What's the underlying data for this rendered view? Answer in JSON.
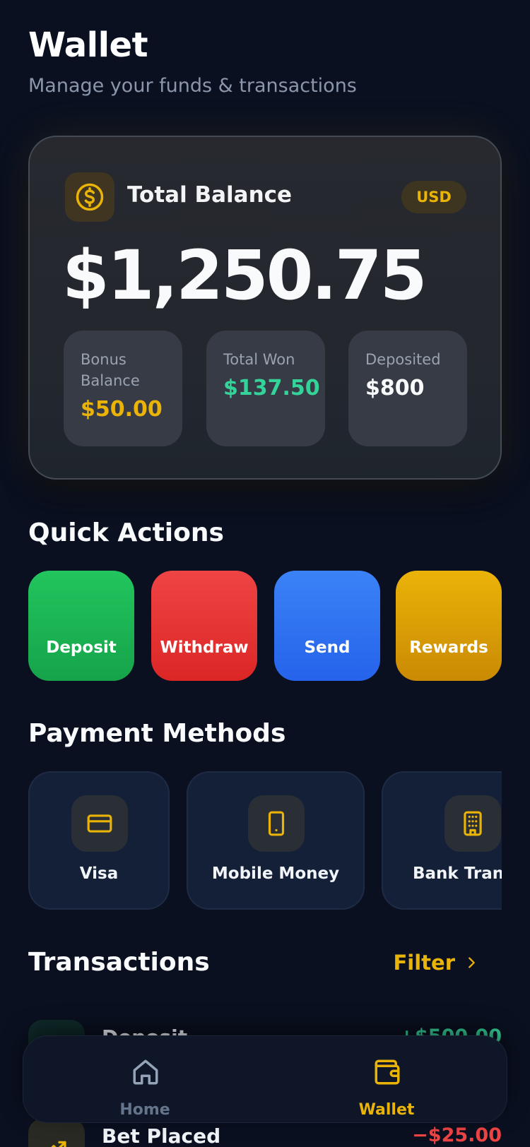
{
  "header": {
    "title": "Wallet",
    "subtitle": "Manage your funds & transactions"
  },
  "balance": {
    "icon": "dollar-coin-icon",
    "title": "Total Balance",
    "currency": "USD",
    "amount": "$1,250.75",
    "stats": [
      {
        "label": "Bonus Balance",
        "value": "$50.00",
        "color": "#eab308"
      },
      {
        "label": "Total Won",
        "value": "$137.50",
        "color": "#34d399"
      },
      {
        "label": "Deposited",
        "value": "$800",
        "color": "#f8fafc"
      }
    ]
  },
  "quick_actions": {
    "title": "Quick Actions",
    "items": [
      {
        "label": "Deposit",
        "color": "#22c55e"
      },
      {
        "label": "Withdraw",
        "color": "#ef4444"
      },
      {
        "label": "Send",
        "color": "#3b82f6"
      },
      {
        "label": "Rewards",
        "color": "#eab308"
      }
    ]
  },
  "payment_methods": {
    "title": "Payment Methods",
    "items": [
      {
        "label": "Visa",
        "icon": "credit-card-icon"
      },
      {
        "label": "Mobile Money",
        "icon": "smartphone-icon"
      },
      {
        "label": "Bank Transfer",
        "icon": "bank-building-icon"
      }
    ]
  },
  "transactions": {
    "title": "Transactions",
    "filter_label": "Filter",
    "items": [
      {
        "title": "Deposit",
        "amount": "+$500.00",
        "color": "#34d399"
      },
      {
        "title": "Bet Placed",
        "amount": "−$25.00",
        "color": "#ef4444"
      }
    ]
  },
  "nav": {
    "items": [
      {
        "label": "Home",
        "icon": "home-icon"
      },
      {
        "label": "Wallet",
        "icon": "wallet-icon"
      }
    ],
    "accent": "#eab308"
  }
}
